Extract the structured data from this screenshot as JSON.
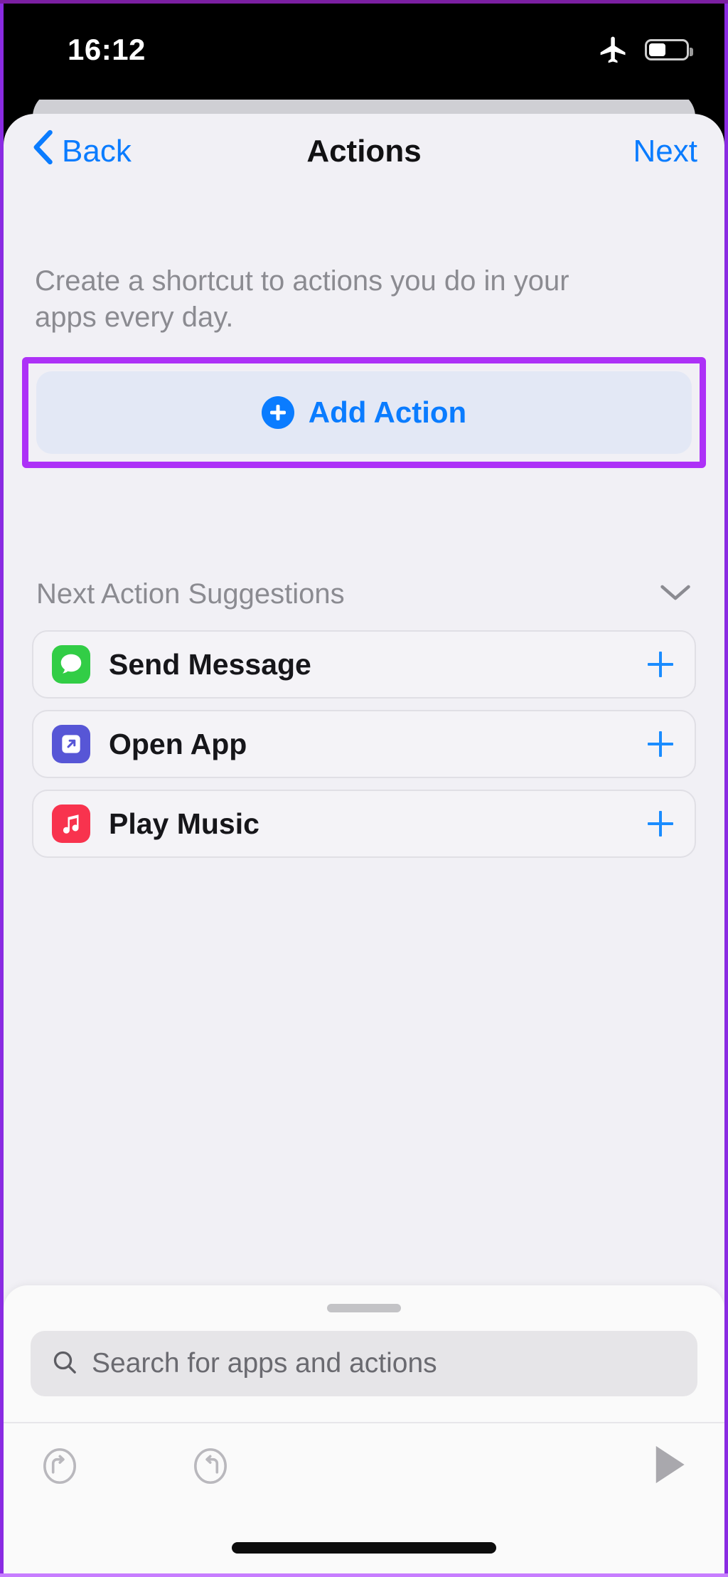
{
  "status_bar": {
    "time": "16:12",
    "airplane_icon": "airplane-mode-icon",
    "battery_icon": "battery-icon",
    "battery_level_percent": 45
  },
  "nav": {
    "back_label": "Back",
    "back_icon": "chevron-left-icon",
    "title": "Actions",
    "next_label": "Next"
  },
  "main": {
    "description": "Create a shortcut to actions you do in your apps every day.",
    "add_action": {
      "label": "Add Action",
      "icon": "plus-circle-icon",
      "highlighted": true,
      "highlight_color": "#ad31f7"
    },
    "suggestions": {
      "header": "Next Action Suggestions",
      "collapse_icon": "chevron-down-icon",
      "items": [
        {
          "label": "Send Message",
          "icon": "messages-app-icon",
          "icon_color": "#32cd46",
          "add_icon": "plus-icon"
        },
        {
          "label": "Open App",
          "icon": "open-app-icon",
          "icon_color": "#5756d6",
          "add_icon": "plus-icon"
        },
        {
          "label": "Play Music",
          "icon": "music-app-icon",
          "icon_color": "#f8334e",
          "add_icon": "plus-icon"
        }
      ]
    }
  },
  "bottom_sheet": {
    "grabber": "sheet-drag-handle",
    "search": {
      "placeholder": "Search for apps and actions",
      "value": "",
      "icon": "search-icon"
    },
    "toolbar": {
      "undo_icon": "undo-icon",
      "redo_icon": "redo-icon",
      "play_icon": "play-icon"
    }
  },
  "colors": {
    "accent_blue": "#0a7cff",
    "highlight_purple": "#ad31f7",
    "sheet_bg": "#f1f0f5"
  }
}
